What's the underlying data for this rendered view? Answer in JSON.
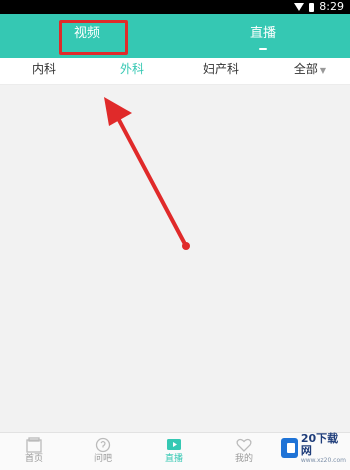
{
  "status_bar": {
    "time": "8:29"
  },
  "top_tabs": [
    {
      "label": "视频"
    },
    {
      "label": "直播"
    }
  ],
  "sub_nav": {
    "items": [
      "内科",
      "外科",
      "妇产科",
      "全部"
    ]
  },
  "bottom_nav": {
    "items": [
      {
        "label": "首页",
        "icon": "home-icon"
      },
      {
        "label": "问吧",
        "icon": "question-icon"
      },
      {
        "label": "直播",
        "icon": "live-tv-icon"
      },
      {
        "label": "我的",
        "icon": "heart-icon"
      }
    ]
  },
  "watermark": {
    "name": "20下载网",
    "url": "www.xz20.com"
  },
  "colors": {
    "accent": "#35c8b3",
    "annotation": "#e02a2a"
  }
}
